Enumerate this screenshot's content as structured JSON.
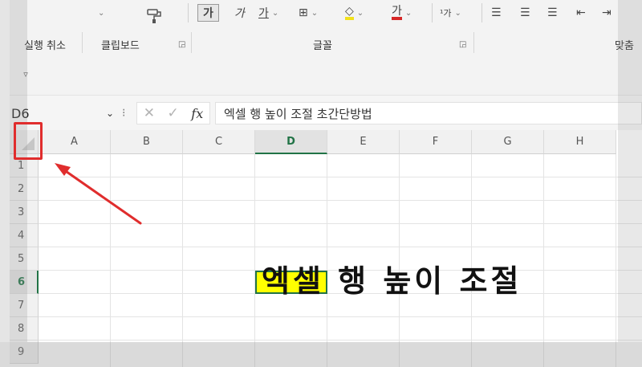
{
  "ribbon": {
    "groups": [
      {
        "label": "실행 취소"
      },
      {
        "label": "클립보드"
      },
      {
        "label": "글꼴"
      },
      {
        "label": "맞춤"
      }
    ],
    "icons": [
      "format-painter-icon",
      "bold-icon",
      "italic-icon",
      "font-size-icon",
      "border-icon",
      "fill-color-icon",
      "font-color-icon",
      "phonetic-icon",
      "align-left-icon",
      "align-center-icon",
      "align-right-icon",
      "decrease-indent-icon",
      "increase-indent-icon"
    ],
    "colors": {
      "fill_color": "#f2e11a",
      "font_color": "#d62626"
    }
  },
  "quick_access": {
    "customize_icon": "customize-quick-access-icon",
    "glyph": "▿"
  },
  "formula_bar": {
    "name_box": "D6",
    "input": "엑셀 행 높이 조절 초간단방법"
  },
  "grid": {
    "columns": [
      "A",
      "B",
      "C",
      "D",
      "E",
      "F",
      "G",
      "H"
    ],
    "rows": [
      "1",
      "2",
      "3",
      "4",
      "5",
      "6",
      "7",
      "8",
      "9"
    ],
    "active_cell": "D6",
    "active_column": "D",
    "active_row": "6",
    "cell_text": "엑셀 행 높이 조절",
    "cell_fill": "#ffff00"
  },
  "annotation": {
    "color": "#e02d2d",
    "target": "select-all-button"
  }
}
